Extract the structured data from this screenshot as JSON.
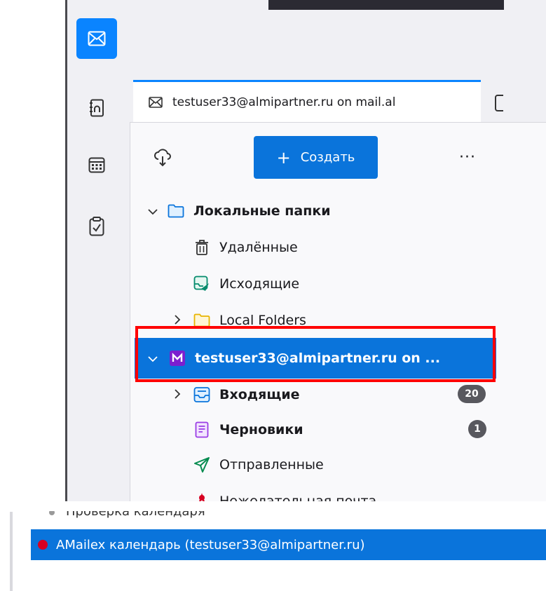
{
  "tab": {
    "title": "testuser33@almipartner.ru on mail.al"
  },
  "toolbar": {
    "create_label": "Создать",
    "create_plus": "+",
    "more_label": "···"
  },
  "folders": {
    "local_root": "Локальные папки",
    "trash": "Удалённые",
    "outbox": "Исходящие",
    "local_folders": "Local Folders",
    "account": "testuser33@almipartner.ru on ...",
    "inbox": "Входящие",
    "inbox_count": "20",
    "drafts": "Черновики",
    "drafts_count": "1",
    "sent": "Отправленные",
    "junk_partial": "Нежелательная почта"
  },
  "calendar": {
    "partial_item": "Проверка календаря",
    "selected_item": "AMailex календарь (testuser33@almipartner.ru)",
    "selected_color": "#d70022"
  },
  "colors": {
    "accent": "#0a74db",
    "highlight_outline": "#ff0000"
  }
}
